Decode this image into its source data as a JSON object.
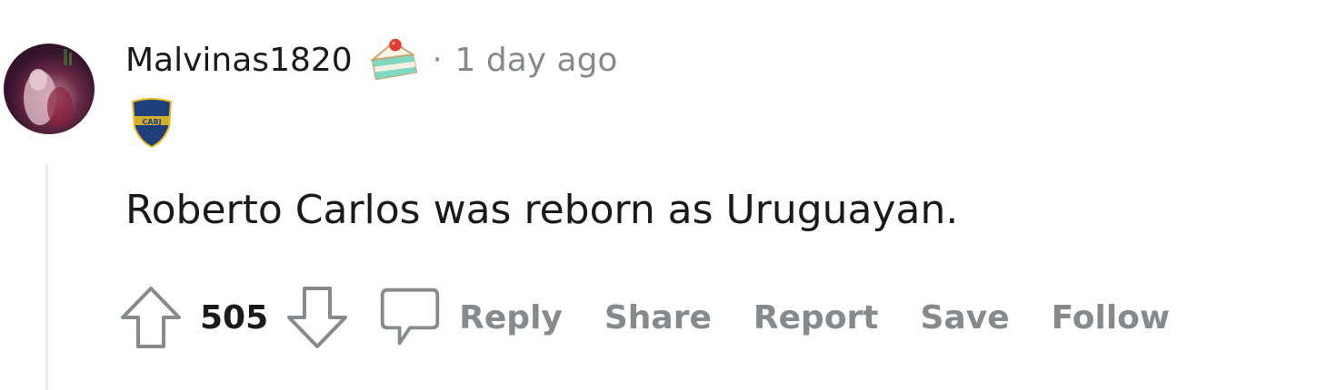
{
  "comment": {
    "username": "Malvinas1820",
    "separator": "·",
    "timestamp": "1 day ago",
    "text": "Roberto Carlos was reborn as Uruguayan.",
    "vote_count": "505",
    "icons": {
      "avatar": "user-avatar",
      "cake_day": "cake-icon",
      "flair": "boca-juniors-crest-icon",
      "upvote": "arrow-up-icon",
      "downvote": "arrow-down-icon",
      "comment": "speech-bubble-icon"
    },
    "flair_text": "CABJ",
    "actions": {
      "reply": "Reply",
      "share": "Share",
      "report": "Report",
      "save": "Save",
      "follow": "Follow"
    },
    "colors": {
      "text": "#1a1a1b",
      "muted": "#878a8c",
      "thread_line": "#e9ebed",
      "flair_blue": "#1d3f7a",
      "flair_gold": "#e8b923"
    }
  }
}
